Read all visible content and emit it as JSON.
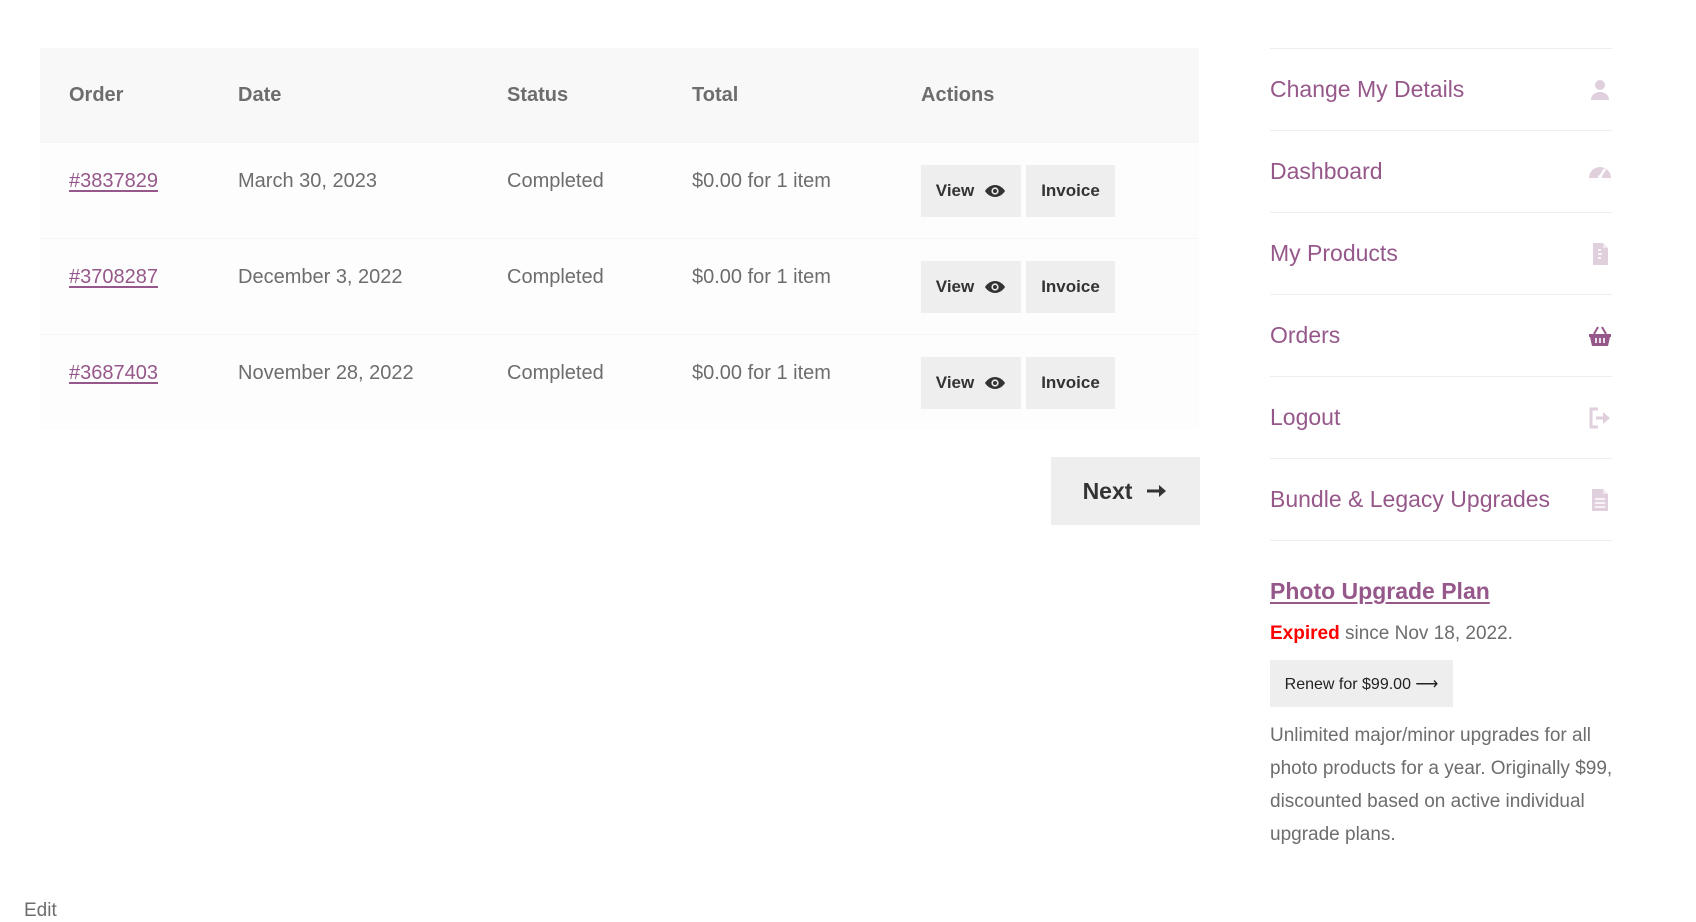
{
  "orders": {
    "headers": [
      "Order",
      "Date",
      "Status",
      "Total",
      "Actions"
    ],
    "rows": [
      {
        "number": "#3837829",
        "date": "March 30, 2023",
        "status": "Completed",
        "total": "$0.00 for 1 item",
        "view": "View",
        "invoice": "Invoice"
      },
      {
        "number": "#3708287",
        "date": "December 3, 2022",
        "status": "Completed",
        "total": "$0.00 for 1 item",
        "view": "View",
        "invoice": "Invoice"
      },
      {
        "number": "#3687403",
        "date": "November 28, 2022",
        "status": "Completed",
        "total": "$0.00 for 1 item",
        "view": "View",
        "invoice": "Invoice"
      }
    ],
    "next_label": "Next"
  },
  "sidebar": {
    "items": [
      {
        "label": "Change My Details",
        "icon": "user-icon"
      },
      {
        "label": "Dashboard",
        "icon": "dashboard-icon"
      },
      {
        "label": "My Products",
        "icon": "file-icon"
      },
      {
        "label": "Orders",
        "icon": "basket-icon"
      },
      {
        "label": "Logout",
        "icon": "logout-icon"
      },
      {
        "label": "Bundle & Legacy Upgrades",
        "icon": "document-icon"
      }
    ]
  },
  "upgrade": {
    "title": "Photo Upgrade Plan",
    "expired_label": "Expired",
    "since_text": " since Nov 18, 2022.",
    "renew_label": "Renew for $99.00 ⟶",
    "description": "Unlimited major/minor upgrades for all photo products for a year. Originally $99, discounted based on active individual upgrade plans."
  },
  "footer": {
    "edit_label": "Edit"
  },
  "colors": {
    "accent": "#96588a",
    "expired": "#ff0000",
    "button_bg": "#eeeeee"
  }
}
